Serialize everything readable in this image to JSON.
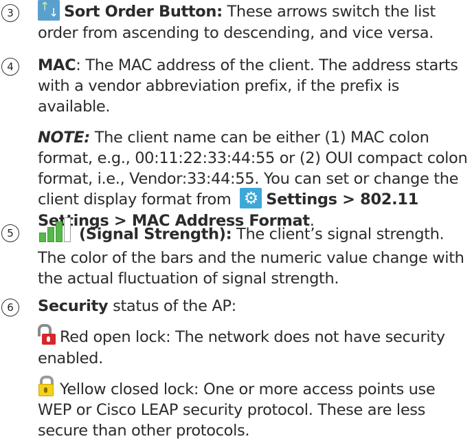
{
  "items": [
    {
      "number": "3",
      "title": "Sort Order Button:",
      "text": " These arrows switch the list order from ascending to descending, and vice versa."
    },
    {
      "number": "4",
      "title": "MAC",
      "text": ": The MAC address of the client. The address starts with a vendor abbreviation prefix, if the prefix is available.",
      "note": {
        "label": "NOTE:",
        "text": " The client name can be either (1) MAC colon format, e.g., 00:11:22:33:44:55 or (2) OUI compact colon format, i.e., Vendor:33:44:55. You can set or change the client display format from ",
        "settings_path": "Settings > 802.11 Settings > MAC Address Format",
        "end": "."
      }
    },
    {
      "number": "5",
      "title": "(Signal Strength):",
      "text": " The client’s signal strength. The color of the bars and the numeric value change with the actual fluctuation of signal strength."
    },
    {
      "number": "6",
      "title": "Security",
      "text": " status of the AP:",
      "red_lock_text": "Red open lock: The network does not have security enabled.",
      "yellow_lock_text": "Yellow closed lock: One or more access points use WEP or Cisco LEAP security protocol. These are less secure than other protocols."
    }
  ],
  "icons": {
    "sort_arrows": "sort-order-arrows-icon",
    "gear": "gear-icon",
    "signal": "signal-strength-bars-icon",
    "red_lock": "red-open-lock-icon",
    "yellow_lock": "yellow-closed-lock-icon"
  },
  "colors": {
    "text": "#2b2b2b",
    "sort_icon_bg": "#5aa0cf",
    "gear_icon_bg": "#3da8d8",
    "signal_green": "#56b84a",
    "lock_red": "#d9262b",
    "lock_yellow": "#f2d21b"
  }
}
